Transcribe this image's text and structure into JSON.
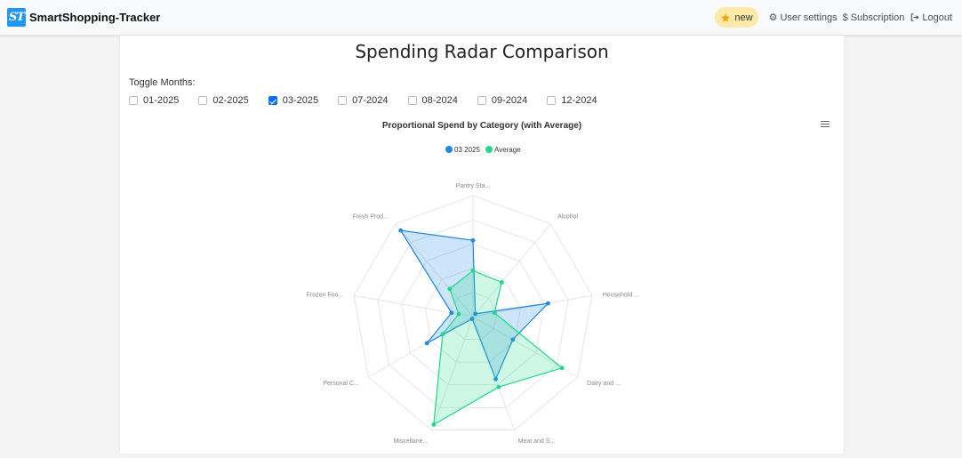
{
  "app": {
    "logo_text": "ST",
    "name": "SmartShopping-Tracker"
  },
  "nav": {
    "new_label": "new",
    "settings_label": "User settings",
    "subscription_label": "Subscription",
    "logout_label": "Logout"
  },
  "page": {
    "title": "Spending Radar Comparison",
    "toggle_label": "Toggle Months:"
  },
  "months": [
    {
      "label": "01-2025",
      "checked": false
    },
    {
      "label": "02-2025",
      "checked": false
    },
    {
      "label": "03-2025",
      "checked": true
    },
    {
      "label": "07-2024",
      "checked": false
    },
    {
      "label": "08-2024",
      "checked": false
    },
    {
      "label": "09-2024",
      "checked": false
    },
    {
      "label": "12-2024",
      "checked": false
    }
  ],
  "colors": {
    "series_1": "#1f87e5",
    "series_2": "#1fd98a",
    "badge": "#fde9a8",
    "accent": "#0d6efd"
  },
  "chart_data": {
    "type": "radar",
    "title": "Proportional Spend by Category (with Average)",
    "categories": [
      "Pantry Sta...",
      "Alcohol",
      "Household ...",
      "Dairy and ...",
      "Meat and S...",
      "Miscellane...",
      "Personal C...",
      "Frozen Foo...",
      "Fresh Prod..."
    ],
    "series": [
      {
        "name": "03 2025",
        "values": [
          0.63,
          0.03,
          0.63,
          0.38,
          0.55,
          0.02,
          0.44,
          0.18,
          0.93
        ]
      },
      {
        "name": "Average",
        "values": [
          0.38,
          0.37,
          0.18,
          0.85,
          0.62,
          0.95,
          0.29,
          0.12,
          0.3
        ]
      }
    ],
    "legend": "top-center",
    "grid": true
  }
}
